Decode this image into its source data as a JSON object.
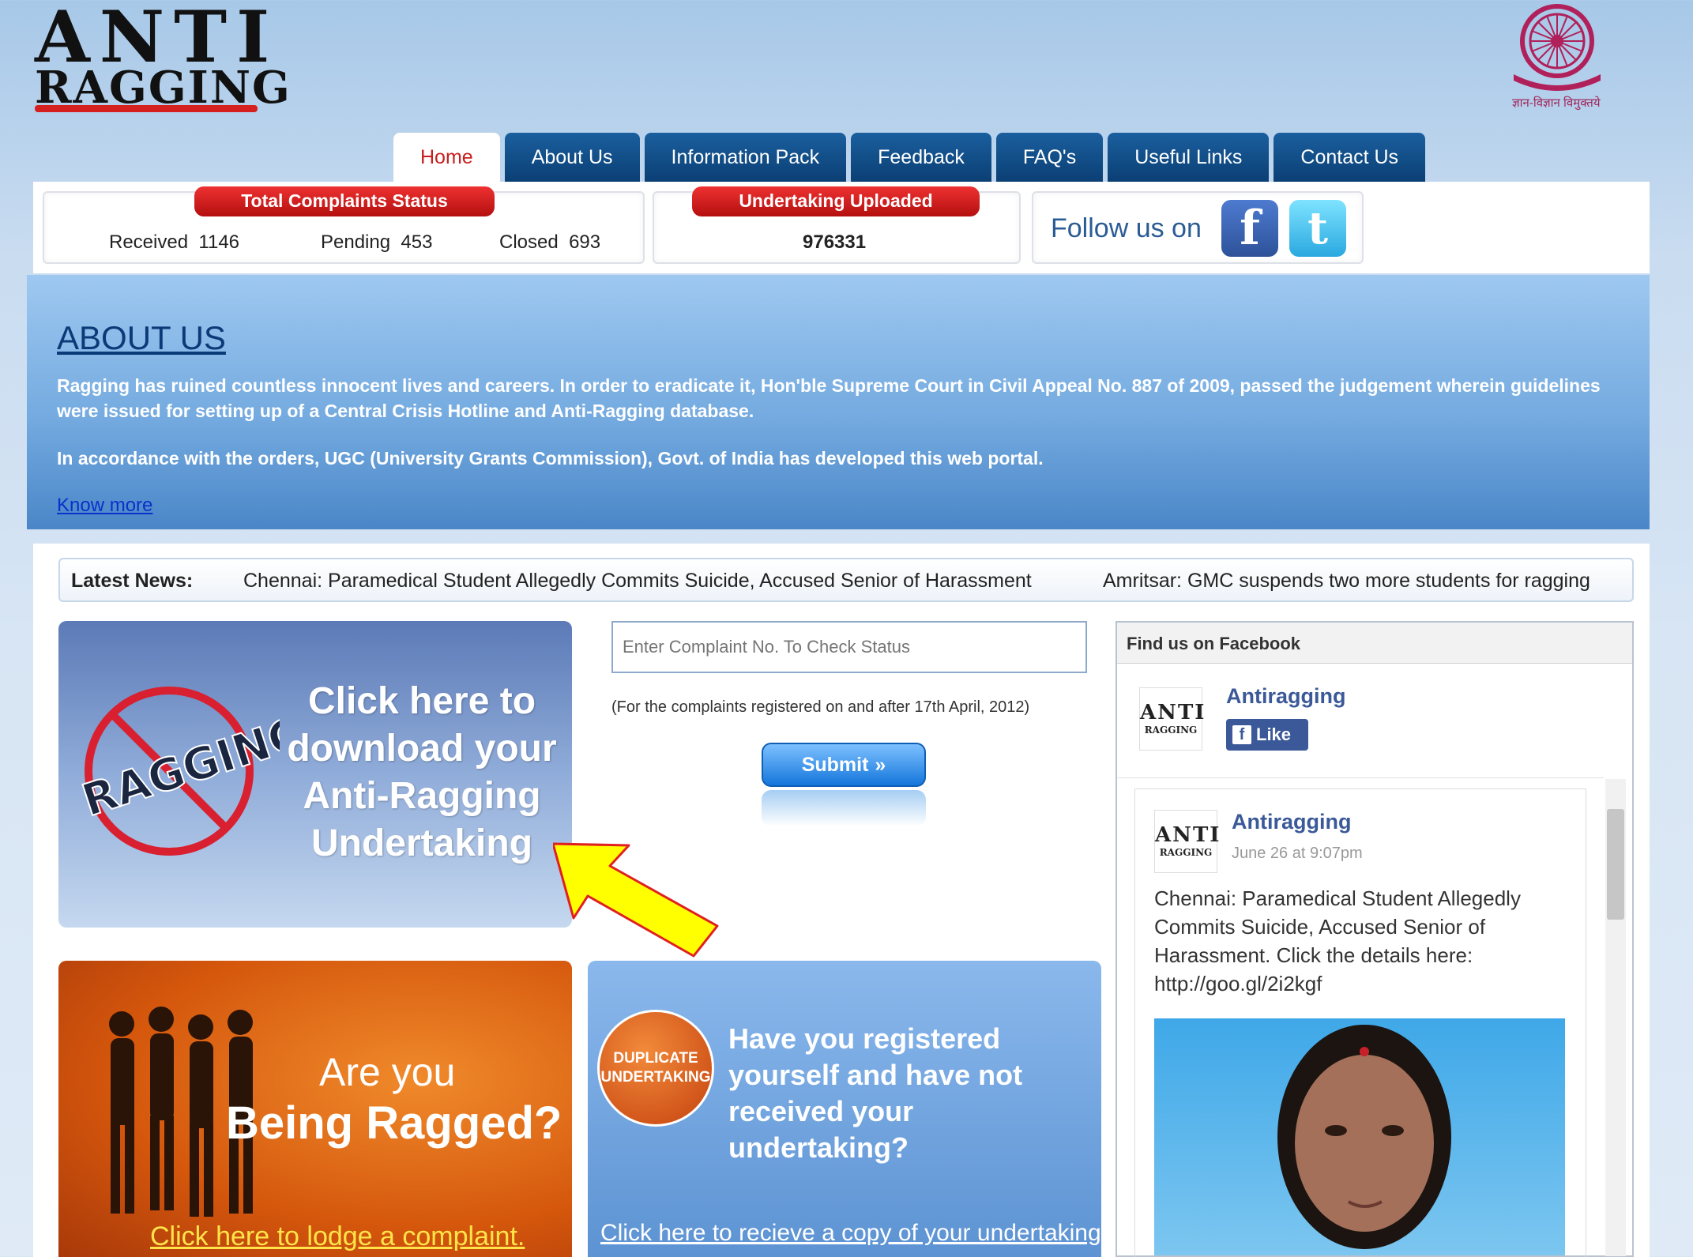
{
  "header": {
    "logo_line1": "ANTI",
    "logo_line2": "RAGGING",
    "emblem_caption": "ज्ञान-विज्ञान विमुक्तये"
  },
  "nav": {
    "tabs": [
      {
        "label": "Home",
        "active": true
      },
      {
        "label": "About Us"
      },
      {
        "label": "Information Pack"
      },
      {
        "label": "Feedback"
      },
      {
        "label": "FAQ's"
      },
      {
        "label": "Useful Links"
      },
      {
        "label": "Contact Us"
      }
    ]
  },
  "status": {
    "complaints_title": "Total Complaints Status",
    "received_label": "Received",
    "received_value": "1146",
    "pending_label": "Pending",
    "pending_value": "453",
    "closed_label": "Closed",
    "closed_value": "693",
    "undertaking_title": "Undertaking Uploaded",
    "undertaking_value": "976331",
    "follow_text": "Follow us on"
  },
  "about": {
    "heading": "ABOUT US",
    "para1": "Ragging has ruined countless innocent lives and careers. In order to eradicate it, Hon'ble Supreme Court in Civil Appeal No. 887 of 2009, passed the judgement wherein guidelines were issued for setting up of a Central Crisis Hotline and Anti-Ragging database.",
    "para2": "In accordance with the orders, UGC (University Grants Commission), Govt. of India has developed this web portal.",
    "link": "Know more"
  },
  "news": {
    "label": "Latest News:",
    "item1": "Chennai: Paramedical Student Allegedly Commits Suicide, Accused Senior of Harassment",
    "item2": "Amritsar: GMC suspends two more students for ragging"
  },
  "undertaking_promo": {
    "stamp": "RAGGING",
    "text": "Click here to download your Anti-Ragging Undertaking"
  },
  "complaint_check": {
    "placeholder": "Enter Complaint No. To Check Status",
    "note": "(For the complaints registered on and after 17th April, 2012)",
    "submit": "Submit"
  },
  "ragged_promo": {
    "line1": "Are you",
    "line2": "Being Ragged?",
    "link": "Click here to lodge a complaint."
  },
  "duplicate_promo": {
    "badge_line1": "DUPLICATE",
    "badge_line2": "UNDERTAKING",
    "text": "Have you registered yourself and have not received your undertaking?",
    "link": "Click here to recieve a copy of your undertaking"
  },
  "facebook": {
    "header": "Find us on Facebook",
    "page_name": "Antiragging",
    "like": "Like",
    "post_author": "Antiragging",
    "post_time": "June 26 at 9:07pm",
    "post_text": "Chennai: Paramedical Student Allegedly Commits Suicide, Accused Senior of Harassment. Click the details here: http://goo.gl/2i2kgf"
  },
  "colors": {
    "nav_blue": "#0b3f74",
    "active_tab_text": "#c81e1e",
    "status_red": "#d81c1c",
    "about_heading": "#0b3a78",
    "facebook_blue": "#3b5998",
    "arrow_yellow": "#ffff00"
  }
}
